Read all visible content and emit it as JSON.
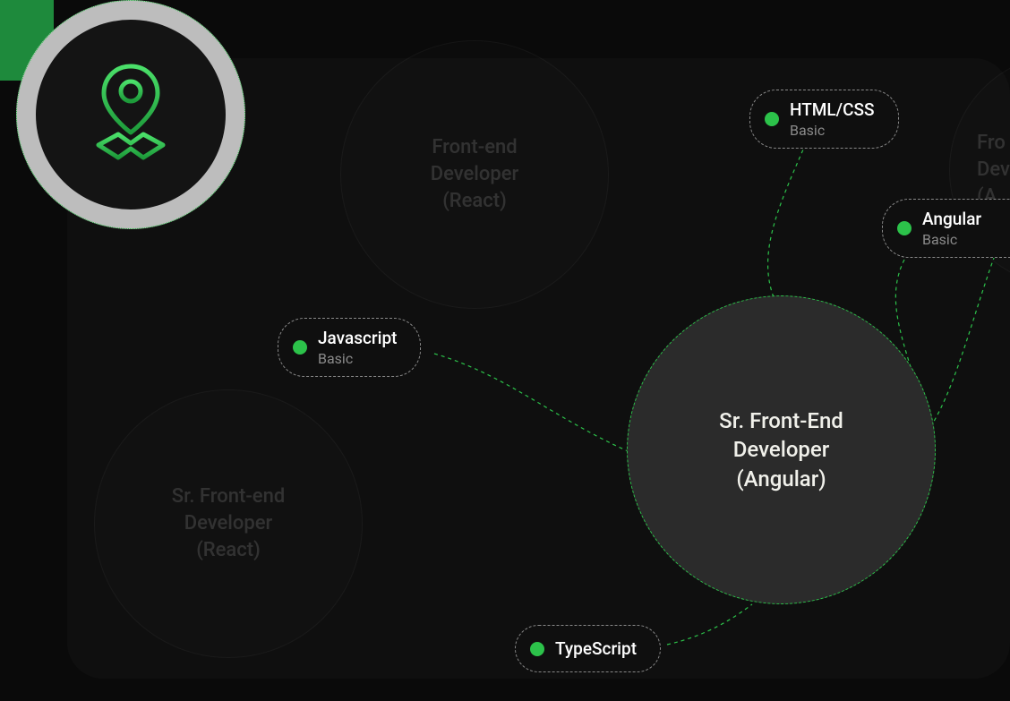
{
  "colors": {
    "accent": "#2cc24a",
    "bg_card": "#0f0f0f",
    "bg_page": "#0a0a0a",
    "halo": "#bdbdbd",
    "role_main_bg": "#2b2b2b"
  },
  "icon": "map-pin-icon",
  "roles": {
    "faded_top": "Front-end\nDeveloper\n(React)",
    "faded_left": "Sr. Front-end\nDeveloper\n(React)",
    "faded_right_cut": "Fro\nDev\n(A",
    "main": "Sr. Front-End\nDeveloper\n(Angular)"
  },
  "skills": {
    "javascript": {
      "name": "Javascript",
      "level": "Basic"
    },
    "htmlcss": {
      "name": "HTML/CSS",
      "level": "Basic"
    },
    "angular": {
      "name": "Angular",
      "level": "Basic"
    },
    "typescript": {
      "name": "TypeScript"
    }
  }
}
